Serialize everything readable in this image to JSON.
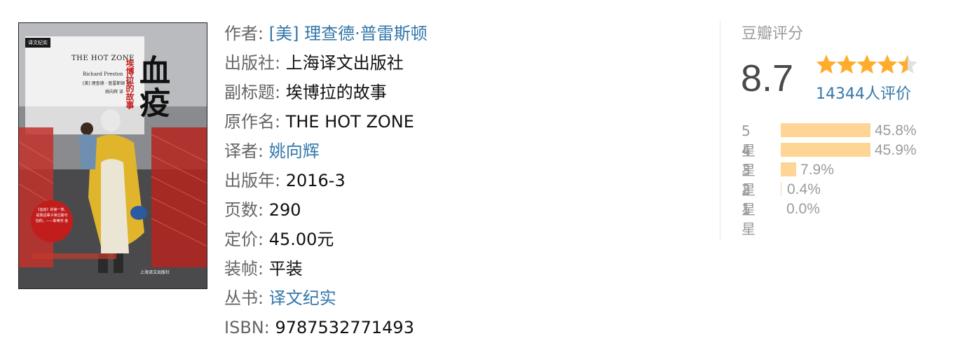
{
  "cover": {
    "publisher_badge": "译文纪实",
    "title_en": "THE HOT ZONE",
    "author_en": "Richard Preston",
    "author_cn": "[美] 理查德 · 普雷斯顿 著",
    "translator_cn": "姚向辉 译",
    "subtitle": "埃博拉的故事",
    "title_cn": "血疫",
    "quote": "《血疫》的第一章，是我这辈子读过最可怕的。——斯蒂芬·金",
    "press": "上海译文出版社"
  },
  "info": {
    "author_label": "作者: ",
    "author_value": "[美] 理查德·普雷斯顿",
    "publisher_label": "出版社: ",
    "publisher_value": "上海译文出版社",
    "subtitle_label": "副标题: ",
    "subtitle_value": "埃博拉的故事",
    "original_label": "原作名: ",
    "original_value": "THE HOT ZONE",
    "translator_label": "译者: ",
    "translator_value": "姚向辉",
    "pubdate_label": "出版年: ",
    "pubdate_value": "2016-3",
    "pages_label": "页数: ",
    "pages_value": "290",
    "price_label": "定价: ",
    "price_value": "45.00元",
    "binding_label": "装帧: ",
    "binding_value": "平装",
    "series_label": "丛书: ",
    "series_value": "译文纪实",
    "isbn_label": "ISBN: ",
    "isbn_value": "9787532771493"
  },
  "rating": {
    "title": "豆瓣评分",
    "score": "8.7",
    "stars_filled": 4.5,
    "stars_total": 5,
    "count": "14344人评价",
    "star_color": "#ffac2d",
    "star_empty_color": "#e0e0e0",
    "bar_color": "#ffd596",
    "distribution": [
      {
        "label": "5星",
        "percent": 45.8,
        "text": "45.8%"
      },
      {
        "label": "4星",
        "percent": 45.9,
        "text": "45.9%"
      },
      {
        "label": "3星",
        "percent": 7.9,
        "text": "7.9%"
      },
      {
        "label": "2星",
        "percent": 0.4,
        "text": "0.4%"
      },
      {
        "label": "1星",
        "percent": 0.0,
        "text": "0.0%"
      }
    ]
  }
}
